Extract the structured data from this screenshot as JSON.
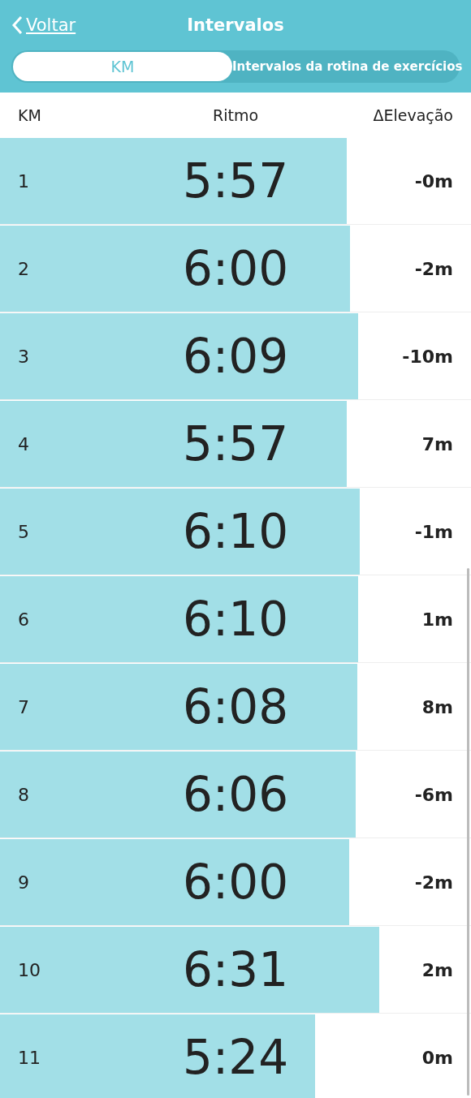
{
  "header": {
    "back_label": "Voltar",
    "title": "Intervalos"
  },
  "tabs": [
    {
      "label": "KM",
      "selected": true
    },
    {
      "label": "Intervalos da rotina de exercícios",
      "selected": false
    }
  ],
  "table": {
    "columns": [
      "KM",
      "Ritmo",
      "ΔElevação"
    ],
    "rows": [
      {
        "km": "1",
        "pace": "5:57",
        "elevation": "-0m",
        "level": 0.736
      },
      {
        "km": "2",
        "pace": "6:00",
        "elevation": "-2m",
        "level": 0.743
      },
      {
        "km": "3",
        "pace": "6:09",
        "elevation": "-10m",
        "level": 0.76
      },
      {
        "km": "4",
        "pace": "5:57",
        "elevation": "7m",
        "level": 0.736
      },
      {
        "km": "5",
        "pace": "6:10",
        "elevation": "-1m",
        "level": 0.764
      },
      {
        "km": "6",
        "pace": "6:10",
        "elevation": "1m",
        "level": 0.76
      },
      {
        "km": "7",
        "pace": "6:08",
        "elevation": "8m",
        "level": 0.759
      },
      {
        "km": "8",
        "pace": "6:06",
        "elevation": "-6m",
        "level": 0.755
      },
      {
        "km": "9",
        "pace": "6:00",
        "elevation": "-2m",
        "level": 0.741
      },
      {
        "km": "10",
        "pace": "6:31",
        "elevation": "2m",
        "level": 0.805
      },
      {
        "km": "11",
        "pace": "5:24",
        "elevation": "0m",
        "level": 0.669
      }
    ]
  }
}
